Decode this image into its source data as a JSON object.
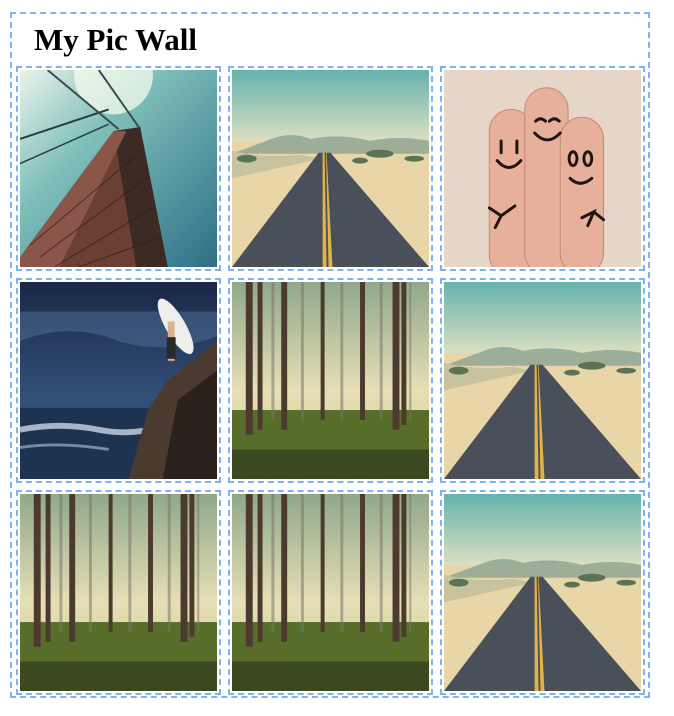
{
  "page": {
    "title": "My Pic Wall"
  },
  "photos": [
    {
      "subject": "bridge-tower"
    },
    {
      "subject": "desert-road"
    },
    {
      "subject": "smiley-fingers"
    },
    {
      "subject": "surfer-cliff"
    },
    {
      "subject": "forest"
    },
    {
      "subject": "desert-road"
    },
    {
      "subject": "forest"
    },
    {
      "subject": "forest"
    },
    {
      "subject": "desert-road"
    }
  ]
}
